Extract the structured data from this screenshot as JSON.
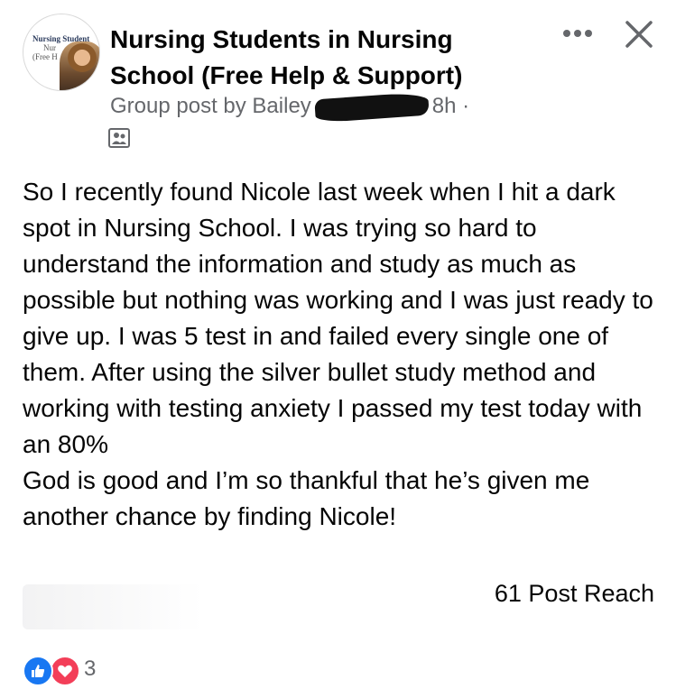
{
  "header": {
    "avatar": {
      "line1": "Nursing Student",
      "line2": "Nur",
      "line3": "(Free H"
    },
    "group_name": "Nursing Students in Nursing School (Free Help & Support)",
    "meta_prefix": "Group post by Bailey",
    "meta_time": "8h ·",
    "icons": {
      "more": "more-horizontal-icon",
      "close": "close-icon",
      "audience": "group-members-icon"
    }
  },
  "post": {
    "paragraph1": "So I recently found Nicole last week when I hit a dark spot in Nursing School. I was trying so hard to understand the information and study as much as possible but nothing was working and I was just ready to give up. I was 5 test in and failed every single one of them. After using the silver bullet study method and working with testing anxiety I passed my test today with an 80%",
    "paragraph2": "God is good and I’m so thankful that he’s given me another chance by finding Nicole!"
  },
  "stats": {
    "reach": "61 Post Reach",
    "reaction_count": "3",
    "reaction_types": [
      "like-icon",
      "love-icon"
    ]
  },
  "colors": {
    "like": "#1877f2",
    "love": "#f33e58",
    "secondary_text": "#65676b",
    "primary_text": "#050505"
  }
}
